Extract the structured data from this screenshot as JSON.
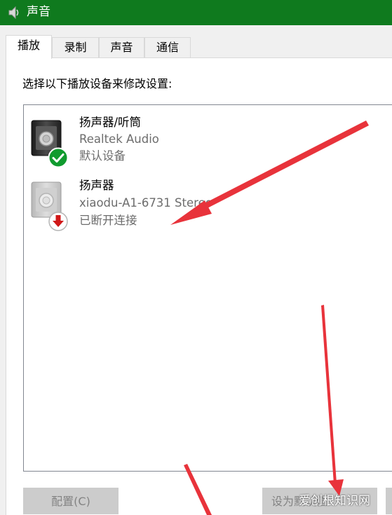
{
  "window": {
    "title": "声音"
  },
  "tabs": [
    {
      "label": "播放",
      "active": true
    },
    {
      "label": "录制",
      "active": false
    },
    {
      "label": "声音",
      "active": false
    },
    {
      "label": "通信",
      "active": false
    }
  ],
  "instruction": "选择以下播放设备来修改设置:",
  "devices": [
    {
      "name": "扬声器/听筒",
      "driver": "Realtek Audio",
      "status": "默认设备",
      "status_icon": "green-check-icon"
    },
    {
      "name": "扬声器",
      "driver": "xiaodu-A1-6731 Stereo",
      "status": "已断开连接",
      "status_icon": "red-down-arrow-icon"
    }
  ],
  "buttons": {
    "configure": "配置(C)",
    "set_default": "设为默认值"
  },
  "watermark": "爱创根知识网",
  "colors": {
    "titlebar": "#0f7a1e",
    "annotation_arrow": "#e8333b",
    "check_badge": "#109b2e",
    "disconnect_arrow": "#d01818"
  }
}
